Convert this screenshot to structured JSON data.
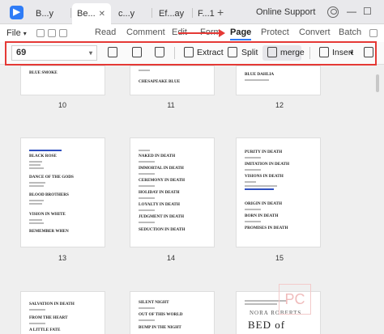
{
  "tabs": [
    {
      "label": "B...y"
    },
    {
      "label": "Be..."
    },
    {
      "label": "c...y"
    },
    {
      "label": "Ef...ay"
    },
    {
      "label": "F...1"
    }
  ],
  "header": {
    "online_support": "Online Support",
    "file_menu": "File"
  },
  "menu_tabs": [
    "Read",
    "Comment",
    "Edit",
    "Form",
    "Page",
    "Protect",
    "Convert",
    "Batch"
  ],
  "toolbar": {
    "page_value": "69",
    "extract": "Extract",
    "split": "Split",
    "merge": "merge",
    "insert": "Insert"
  },
  "page_numbers": [
    "10",
    "11",
    "12",
    "13",
    "14",
    "15"
  ],
  "top_row": {
    "p10_title": "BLUE SMOKE",
    "p11_title": "CHESAPEAKE BLUE",
    "p12_title": "BLUE DAHLIA"
  },
  "page13_lines": [
    "BLACK ROSE",
    "DANCE OF THE GODS",
    "BLOOD BROTHERS",
    "VISION IN WHITE",
    "REMEMBER WHEN"
  ],
  "page14_lines": [
    "NAKED IN DEATH",
    "IMMORTAL IN DEATH",
    "CEREMONY IN DEATH",
    "HOLIDAY IN DEATH",
    "LOYALTY IN DEATH",
    "JUDGMENT IN DEATH",
    "SEDUCTION IN DEATH"
  ],
  "page15_lines": [
    "PURITY IN DEATH",
    "IMITATION IN DEATH",
    "VISIONS IN DEATH",
    "ORIGIN IN DEATH",
    "BORN IN DEATH",
    "PROMISES IN DEATH"
  ],
  "bottom_row": {
    "b1_lines": [
      "SALVATION IN DEATH",
      "FROM THE HEART",
      "A LITTLE FATE"
    ],
    "b2_lines": [
      "SILENT NIGHT",
      "OUT OF THIS WORLD",
      "BUMP IN THE NIGHT"
    ],
    "cover_author": "NORA ROBERTS",
    "cover_title": "BED of ROSES"
  },
  "watermark": "PC",
  "colors": {
    "accent": "#2f7cf6",
    "highlight_box": "#e53935"
  }
}
